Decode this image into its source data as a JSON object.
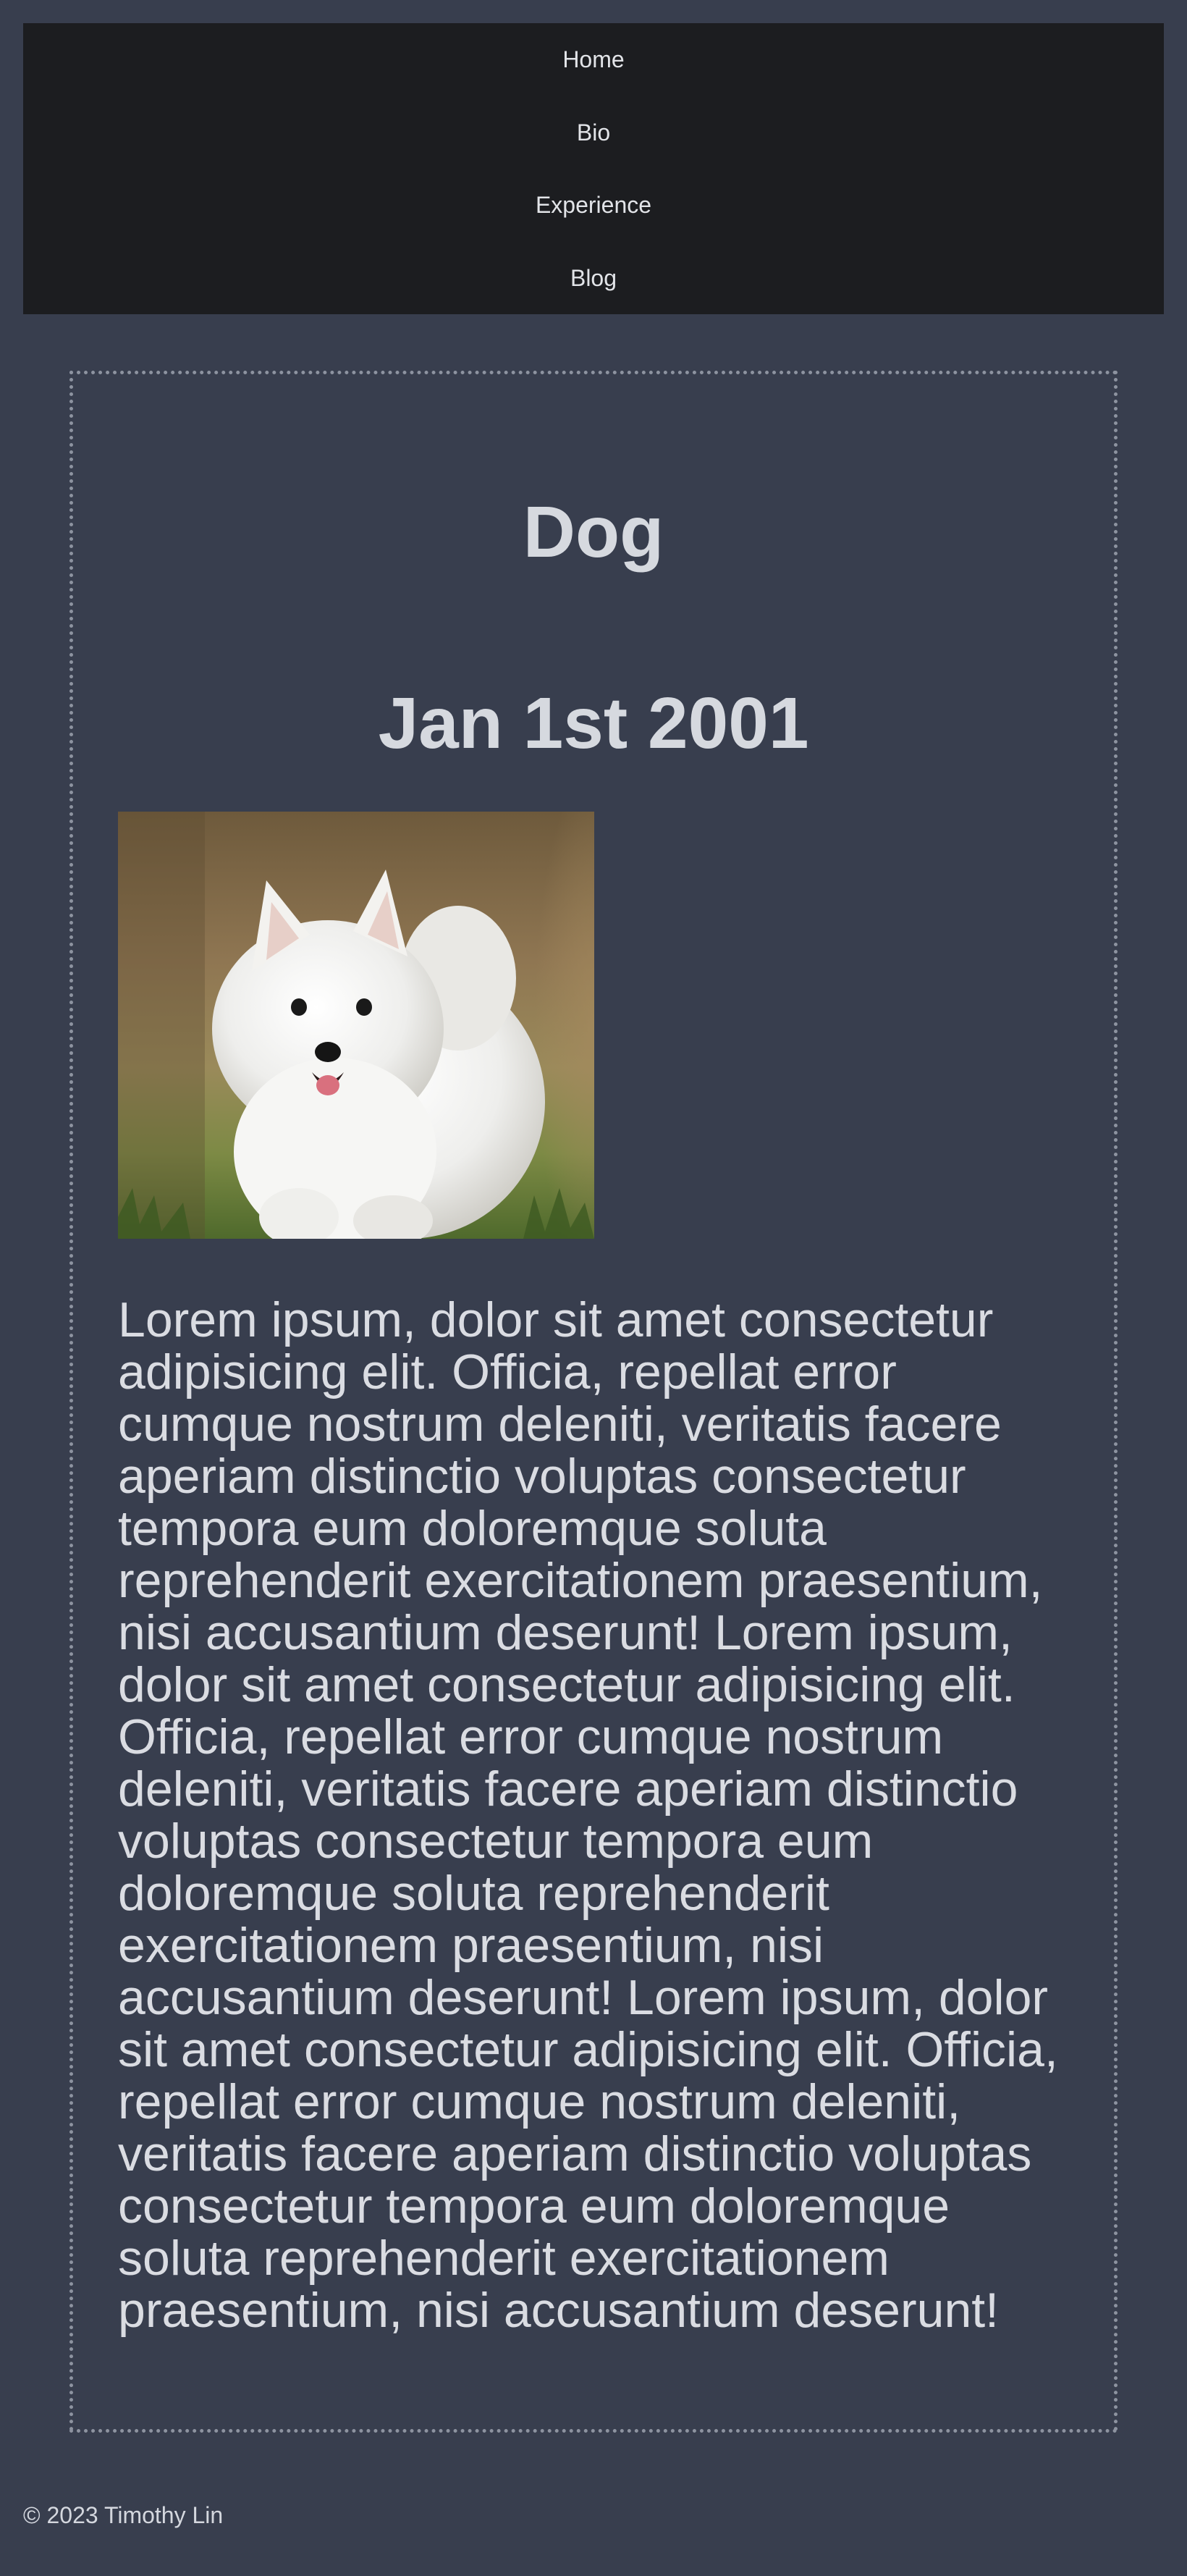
{
  "nav": {
    "items": [
      {
        "label": "Home"
      },
      {
        "label": "Bio"
      },
      {
        "label": "Experience"
      },
      {
        "label": "Blog"
      }
    ]
  },
  "post": {
    "title": "Dog",
    "date": "Jan 1st 2001",
    "image_subject": "white fluffy puppy",
    "body": "Lorem ipsum, dolor sit amet consectetur adipisicing elit. Officia, repellat error cumque nostrum deleniti, veritatis facere aperiam distinctio voluptas consectetur tempora eum doloremque soluta reprehenderit exercitationem praesentium, nisi accusantium deserunt! Lorem ipsum, dolor sit amet consectetur adipisicing elit. Officia, repellat error cumque nostrum deleniti, veritatis facere aperiam distinctio voluptas consectetur tempora eum doloremque soluta reprehenderit exercitationem praesentium, nisi accusantium deserunt! Lorem ipsum, dolor sit amet consectetur adipisicing elit. Officia, repellat error cumque nostrum deleniti, veritatis facere aperiam distinctio voluptas consectetur tempora eum doloremque soluta reprehenderit exercitationem praesentium, nisi accusantium deserunt!"
  },
  "footer": {
    "text": "© 2023 Timothy Lin"
  },
  "colors": {
    "page_background": "#383e4e",
    "nav_background": "#1c1d20",
    "text": "#d4d7de",
    "card_border": "#8d93a0"
  }
}
